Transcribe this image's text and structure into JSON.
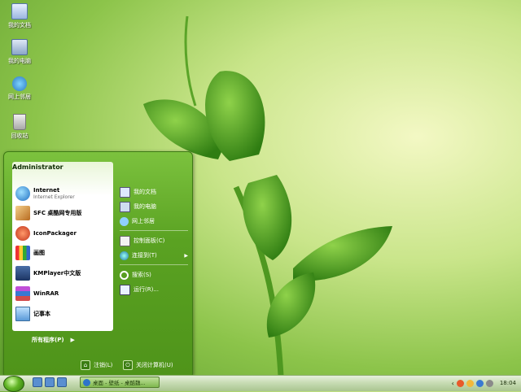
{
  "desktop": {
    "icons": [
      {
        "label": "我的文档",
        "icon": "my-documents-icon"
      },
      {
        "label": "我的电脑",
        "icon": "my-computer-icon"
      },
      {
        "label": "网上邻居",
        "icon": "network-icon"
      },
      {
        "label": "回收站",
        "icon": "recycle-bin-icon"
      }
    ]
  },
  "start_menu": {
    "user": "Administrator",
    "pinned": [
      {
        "title": "Internet",
        "subtitle": "Internet Explorer",
        "icon": "internet-explorer-icon"
      },
      {
        "title": "SFC 桌酷网专用版",
        "icon": "sfc-icon"
      },
      {
        "title": "IconPackager",
        "icon": "iconpackager-icon"
      },
      {
        "title": "画图",
        "icon": "paint-icon"
      },
      {
        "title": "KMPlayer中文版",
        "icon": "kmplayer-icon"
      },
      {
        "title": "WinRAR",
        "icon": "winrar-icon"
      },
      {
        "title": "记事本",
        "icon": "notepad-icon"
      }
    ],
    "all_programs": "所有程序(P)",
    "right": [
      {
        "label": "我的文档",
        "icon": "my-documents-icon"
      },
      {
        "label": "我的电脑",
        "icon": "my-computer-icon"
      },
      {
        "label": "网上邻居",
        "icon": "network-icon"
      },
      {
        "label": "控制面板(C)",
        "icon": "control-panel-icon"
      },
      {
        "label": "连接到(T)",
        "icon": "connect-icon"
      },
      {
        "label": "搜索(S)",
        "icon": "search-icon"
      },
      {
        "label": "运行(R)...",
        "icon": "run-icon"
      }
    ],
    "logoff": "注销(L)",
    "shutdown": "关闭计算机(U)"
  },
  "taskbar": {
    "task_label": "桌面 - 壁纸 - 桌酷魏...",
    "clock": "18:04"
  },
  "colors": {
    "start_menu": "#5aa222",
    "taskbar": "#c8dcb4"
  }
}
